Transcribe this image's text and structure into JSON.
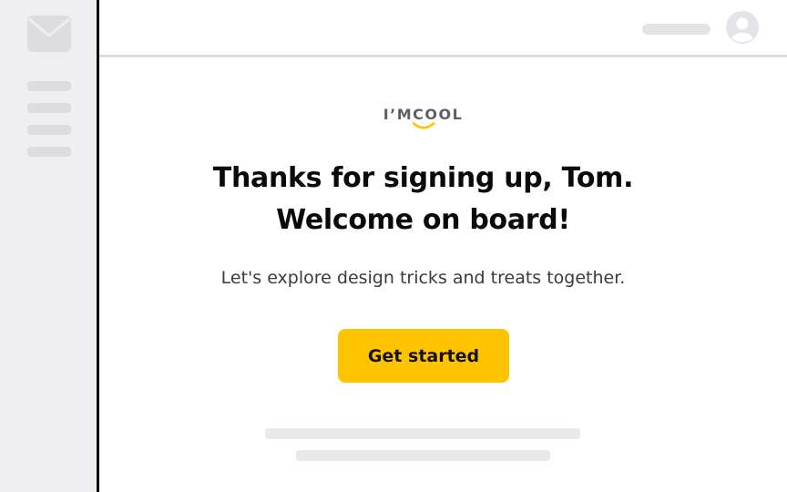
{
  "brand": {
    "logo_text": "I’MCOOL",
    "accent_color": "#ffc400"
  },
  "sidebar": {
    "icon": "mail-icon",
    "placeholder_lines": 4
  },
  "header": {
    "avatar_icon": "user-avatar-icon"
  },
  "email": {
    "headline_line1": "Thanks for signing up, Tom.",
    "headline_line2": "Welcome on board!",
    "subtext": "Let's explore design tricks and treats together.",
    "cta_label": "Get started"
  }
}
